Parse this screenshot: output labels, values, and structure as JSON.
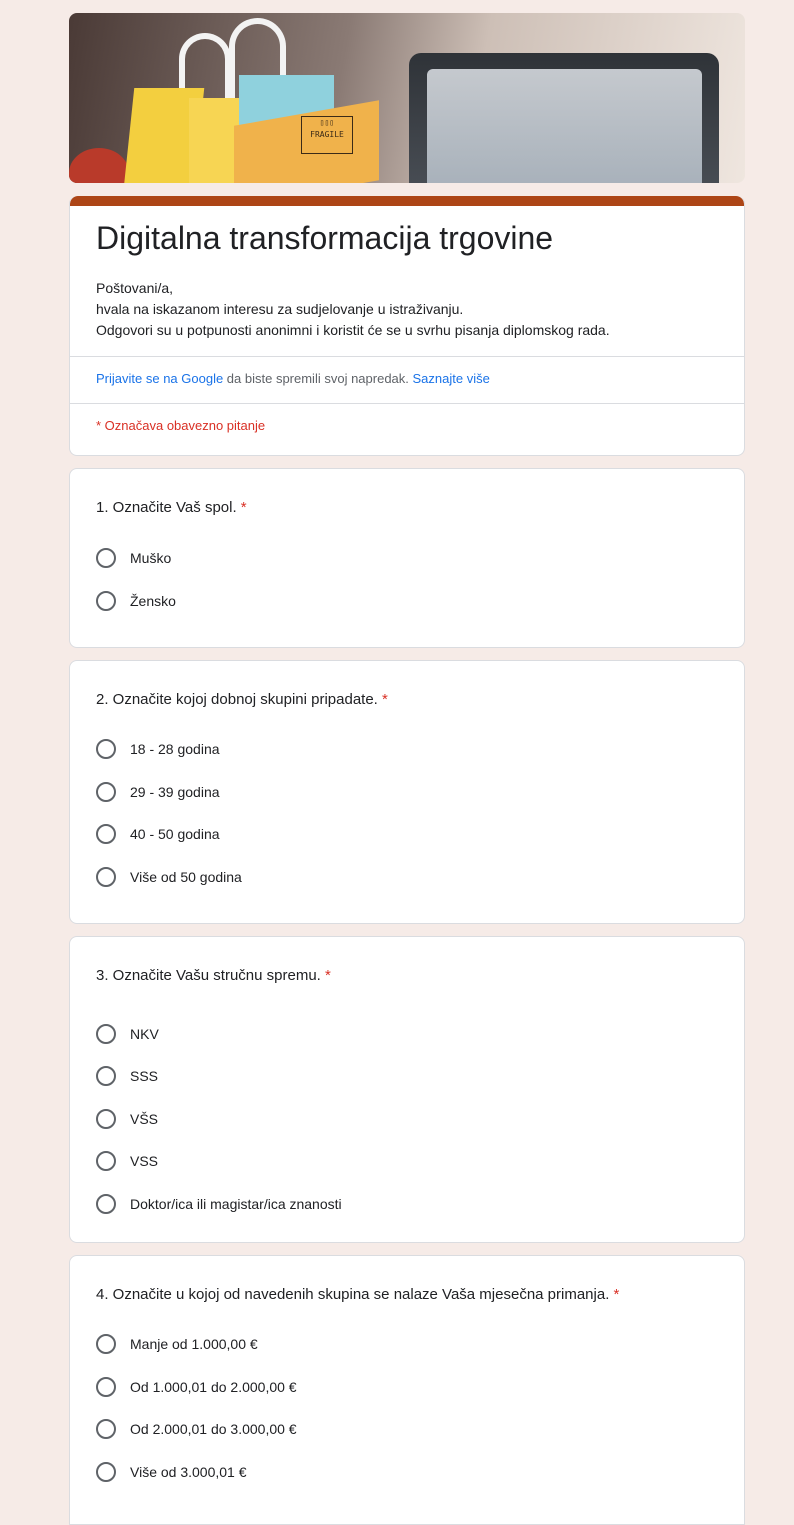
{
  "banner": {
    "box_text": "FRAGILE"
  },
  "form": {
    "title": "Digitalna transformacija trgovine",
    "description": [
      "Poštovani/a,",
      "hvala na iskazanom interesu za sudjelovanje u istraživanju.",
      "Odgovori su u potpunosti anonimni i koristit će se u svrhu pisanja diplomskog rada."
    ],
    "signin": {
      "link": "Prijavite se na Google",
      "middle": " da biste spremili svoj napredak. ",
      "learn_more": "Saznajte više"
    },
    "required_note": "* Označava obavezno pitanje"
  },
  "questions": [
    {
      "title": "1. Označite Vaš spol.",
      "required_mark": "*",
      "options": [
        "Muško",
        "Žensko"
      ]
    },
    {
      "title": "2. Označite kojoj dobnoj skupini pripadate.",
      "required_mark": "*",
      "options": [
        "18 - 28 godina",
        "29 - 39 godina",
        "40 - 50 godina",
        "Više od 50 godina"
      ]
    },
    {
      "title": "3. Označite Vašu stručnu spremu.",
      "required_mark": "*",
      "options": [
        "NKV",
        "SSS",
        "VŠS",
        "VSS",
        "Doktor/ica ili magistar/ica znanosti"
      ]
    },
    {
      "title": "4. Označite u kojoj od navedenih skupina se nalaze Vaša mjesečna primanja.",
      "required_mark": "*",
      "options": [
        "Manje od 1.000,00 €",
        "Od 1.000,01 do 2.000,00 €",
        "Od 2.000,01 do 3.000,00 €",
        "Više od 3.000,01 €"
      ]
    }
  ],
  "colors": {
    "background": "#f6ebe7",
    "accent": "#ad4516",
    "required": "#d93025",
    "link": "#1a73e8"
  }
}
